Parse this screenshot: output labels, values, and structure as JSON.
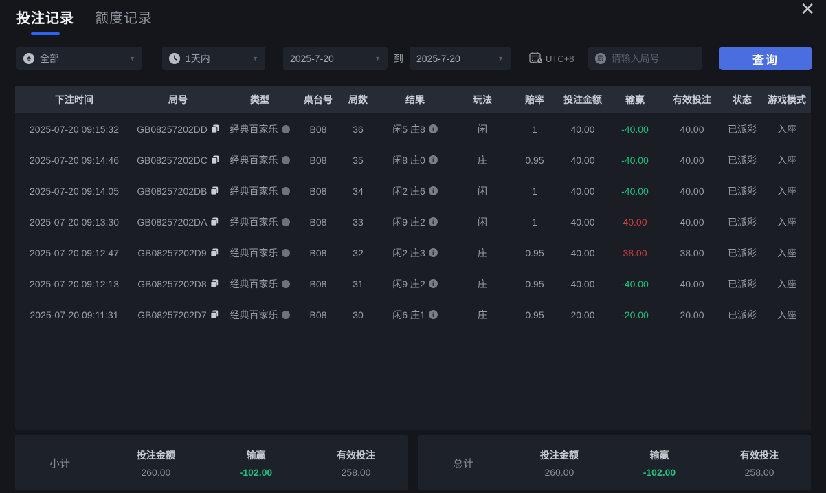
{
  "colors": {
    "accent_blue": "#4a6de0",
    "tab_underline": "#2e63f6",
    "negative_green": "#22c17d",
    "positive_red": "#cd4040"
  },
  "icons": {
    "close": "✕",
    "chevron": "▼",
    "spade": "♠",
    "round_badge": "局",
    "info": "i"
  },
  "tabs": [
    {
      "label": "投注记录",
      "active": true
    },
    {
      "label": "额度记录",
      "active": false
    }
  ],
  "filters": {
    "game_type_value": "全部",
    "time_range_value": "1天内",
    "date_from": "2025-7-20",
    "date_to_label": "到",
    "date_to": "2025-7-20",
    "timezone": "UTC+8",
    "round_placeholder": "请输入局号",
    "query_button": "查询"
  },
  "table": {
    "headers": [
      "下注时间",
      "局号",
      "类型",
      "桌台号",
      "局数",
      "结果",
      "玩法",
      "赔率",
      "投注金额",
      "输赢",
      "有效投注",
      "状态",
      "游戏模式"
    ],
    "rows": [
      {
        "time": "2025-07-20 09:15:32",
        "round_id": "GB08257202DD",
        "type": "经典百家乐",
        "table_no": "B08",
        "round_no": "36",
        "result": "闲5 庄8",
        "play": "闲",
        "odds": "1",
        "bet_amount": "40.00",
        "win_loss": "-40.00",
        "sign": "neg",
        "valid_bet": "40.00",
        "status": "已派彩",
        "mode": "入座"
      },
      {
        "time": "2025-07-20 09:14:46",
        "round_id": "GB08257202DC",
        "type": "经典百家乐",
        "table_no": "B08",
        "round_no": "35",
        "result": "闲8 庄0",
        "play": "庄",
        "odds": "0.95",
        "bet_amount": "40.00",
        "win_loss": "-40.00",
        "sign": "neg",
        "valid_bet": "40.00",
        "status": "已派彩",
        "mode": "入座"
      },
      {
        "time": "2025-07-20 09:14:05",
        "round_id": "GB08257202DB",
        "type": "经典百家乐",
        "table_no": "B08",
        "round_no": "34",
        "result": "闲2 庄6",
        "play": "闲",
        "odds": "1",
        "bet_amount": "40.00",
        "win_loss": "-40.00",
        "sign": "neg",
        "valid_bet": "40.00",
        "status": "已派彩",
        "mode": "入座"
      },
      {
        "time": "2025-07-20 09:13:30",
        "round_id": "GB08257202DA",
        "type": "经典百家乐",
        "table_no": "B08",
        "round_no": "33",
        "result": "闲9 庄2",
        "play": "闲",
        "odds": "1",
        "bet_amount": "40.00",
        "win_loss": "40.00",
        "sign": "pos",
        "valid_bet": "40.00",
        "status": "已派彩",
        "mode": "入座"
      },
      {
        "time": "2025-07-20 09:12:47",
        "round_id": "GB08257202D9",
        "type": "经典百家乐",
        "table_no": "B08",
        "round_no": "32",
        "result": "闲2 庄3",
        "play": "庄",
        "odds": "0.95",
        "bet_amount": "40.00",
        "win_loss": "38.00",
        "sign": "pos",
        "valid_bet": "38.00",
        "status": "已派彩",
        "mode": "入座"
      },
      {
        "time": "2025-07-20 09:12:13",
        "round_id": "GB08257202D8",
        "type": "经典百家乐",
        "table_no": "B08",
        "round_no": "31",
        "result": "闲9 庄2",
        "play": "庄",
        "odds": "0.95",
        "bet_amount": "40.00",
        "win_loss": "-40.00",
        "sign": "neg",
        "valid_bet": "40.00",
        "status": "已派彩",
        "mode": "入座"
      },
      {
        "time": "2025-07-20 09:11:31",
        "round_id": "GB08257202D7",
        "type": "经典百家乐",
        "table_no": "B08",
        "round_no": "30",
        "result": "闲6 庄1",
        "play": "庄",
        "odds": "0.95",
        "bet_amount": "20.00",
        "win_loss": "-20.00",
        "sign": "neg",
        "valid_bet": "20.00",
        "status": "已派彩",
        "mode": "入座"
      }
    ]
  },
  "subtotal": {
    "label": "小计",
    "bet_amount_label": "投注金额",
    "bet_amount": "260.00",
    "win_loss_label": "输赢",
    "win_loss": "-102.00",
    "valid_bet_label": "有效投注",
    "valid_bet": "258.00"
  },
  "total": {
    "label": "总计",
    "bet_amount_label": "投注金额",
    "bet_amount": "260.00",
    "win_loss_label": "输赢",
    "win_loss": "-102.00",
    "valid_bet_label": "有效投注",
    "valid_bet": "258.00"
  }
}
